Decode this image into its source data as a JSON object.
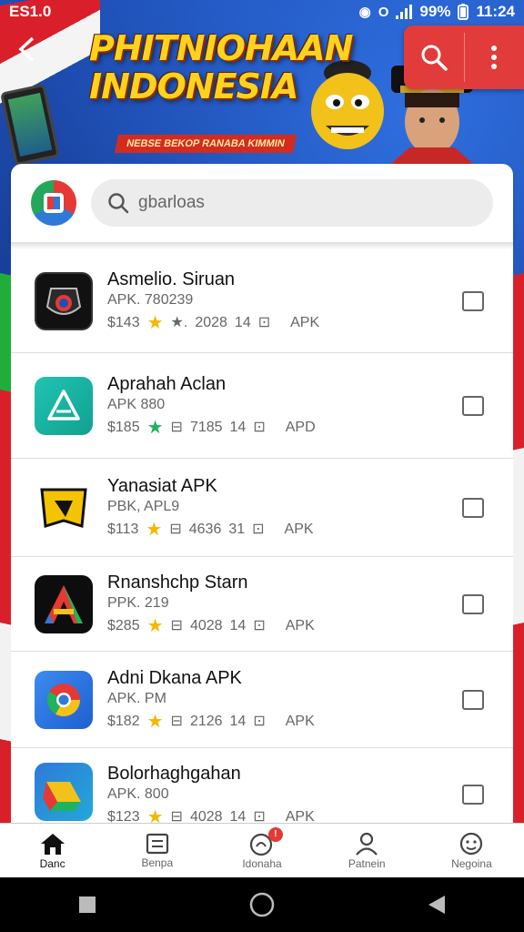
{
  "status_bar": {
    "left_text": "ES1.0",
    "battery": "99%",
    "time": "11:24"
  },
  "banner": {
    "title_line1": "PHITNIOHAAN",
    "title_line2": "INDONESIA",
    "subtitle": "NEBSE BEKOP RANABA KIMMIN"
  },
  "search": {
    "text": "gbarloas"
  },
  "apps": [
    {
      "title": "Asmelio. Siruan",
      "subtitle": "APK. 780239",
      "price": "$143",
      "rating": "2028",
      "size": "14",
      "type": "APK",
      "icon": "shield-app-icon",
      "star_color": "#f5b800"
    },
    {
      "title": "Aprahah Aclan",
      "subtitle": "APK 880",
      "price": "$185",
      "rating": "7185",
      "size": "14",
      "type": "APD",
      "icon": "triangle-app-icon",
      "star_color": "#1fb35b"
    },
    {
      "title": "Yanasiat APK",
      "subtitle": "PBK, APL9",
      "price": "$113",
      "rating": "4636",
      "size": "31",
      "type": "APK",
      "icon": "yellow-app-icon",
      "star_color": "#f5b800"
    },
    {
      "title": "Rnanshchp Starn",
      "subtitle": "PPK. 219",
      "price": "$285",
      "rating": "4028",
      "size": "14",
      "type": "APK",
      "icon": "letter-a-app-icon",
      "star_color": "#f5b800"
    },
    {
      "title": "Adni Dkana APK",
      "subtitle": "APK. PM",
      "price": "$182",
      "rating": "2126",
      "size": "14",
      "type": "APK",
      "icon": "chrome-app-icon",
      "star_color": "#f5b800"
    },
    {
      "title": "Bolorhaghgahan",
      "subtitle": "APK. 800",
      "price": "$123",
      "rating": "4028",
      "size": "14",
      "type": "APK",
      "icon": "drive-app-icon",
      "star_color": "#f5b800"
    }
  ],
  "bottom_nav": [
    {
      "label": "Danc",
      "icon": "home-icon",
      "active": true
    },
    {
      "label": "Benpa",
      "icon": "list-icon",
      "active": false
    },
    {
      "label": "Idonaha",
      "icon": "notification-icon",
      "active": false,
      "badge": "!"
    },
    {
      "label": "Patnein",
      "icon": "person-icon",
      "active": false
    },
    {
      "label": "Negoina",
      "icon": "smiley-icon",
      "active": false
    }
  ],
  "colors": {
    "accent_red": "#e23b3b",
    "banner_blue": "#1e4fb6",
    "star_yellow": "#f5b800",
    "title_yellow": "#ffd21f"
  }
}
